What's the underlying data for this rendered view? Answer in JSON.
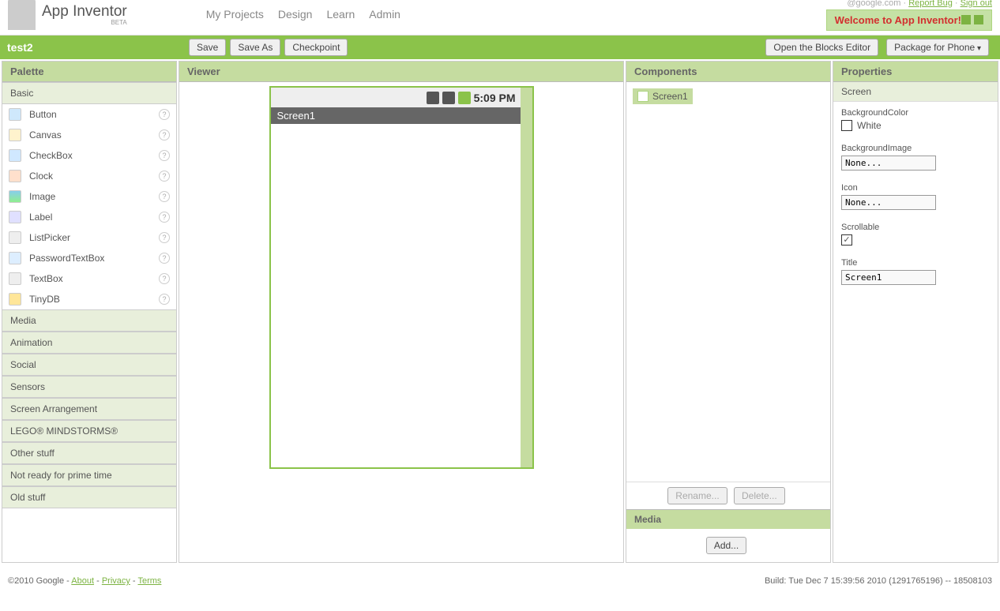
{
  "header": {
    "app_title": "App Inventor",
    "beta": "BETA",
    "nav": [
      "My Projects",
      "Design",
      "Learn",
      "Admin"
    ],
    "user_email_partial": "@google.com",
    "report_bug": "Report Bug",
    "sign_out": "Sign out",
    "welcome": "Welcome to App Inventor!"
  },
  "toolbar": {
    "project_name": "test2",
    "save": "Save",
    "save_as": "Save As",
    "checkpoint": "Checkpoint",
    "open_blocks": "Open the Blocks Editor",
    "package": "Package for Phone"
  },
  "palette": {
    "title": "Palette",
    "sections_open": "Basic",
    "basic_items": [
      {
        "label": "Button",
        "icon": "icon-button"
      },
      {
        "label": "Canvas",
        "icon": "icon-canvas"
      },
      {
        "label": "CheckBox",
        "icon": "icon-checkbox"
      },
      {
        "label": "Clock",
        "icon": "icon-clock"
      },
      {
        "label": "Image",
        "icon": "icon-image"
      },
      {
        "label": "Label",
        "icon": "icon-label"
      },
      {
        "label": "ListPicker",
        "icon": "icon-listpicker"
      },
      {
        "label": "PasswordTextBox",
        "icon": "icon-password"
      },
      {
        "label": "TextBox",
        "icon": "icon-textbox"
      },
      {
        "label": "TinyDB",
        "icon": "icon-tinydb"
      }
    ],
    "sections_closed": [
      "Media",
      "Animation",
      "Social",
      "Sensors",
      "Screen Arrangement",
      "LEGO® MINDSTORMS®",
      "Other stuff",
      "Not ready for prime time",
      "Old stuff"
    ]
  },
  "viewer": {
    "title": "Viewer",
    "phone_time": "5:09 PM",
    "screen_title": "Screen1"
  },
  "components": {
    "title": "Components",
    "root": "Screen1",
    "rename": "Rename...",
    "delete": "Delete...",
    "media_title": "Media",
    "add": "Add..."
  },
  "properties": {
    "title": "Properties",
    "selected": "Screen",
    "bgcolor_label": "BackgroundColor",
    "bgcolor_value": "White",
    "bgimage_label": "BackgroundImage",
    "bgimage_value": "None...",
    "icon_label": "Icon",
    "icon_value": "None...",
    "scrollable_label": "Scrollable",
    "scrollable_checked": true,
    "title_label": "Title",
    "title_value": "Screen1"
  },
  "footer": {
    "copyright": "©2010 Google - ",
    "about": "About",
    "privacy": "Privacy",
    "terms": "Terms",
    "build": "Build: Tue Dec 7 15:39:56 2010 (1291765196) -- 18508103"
  }
}
